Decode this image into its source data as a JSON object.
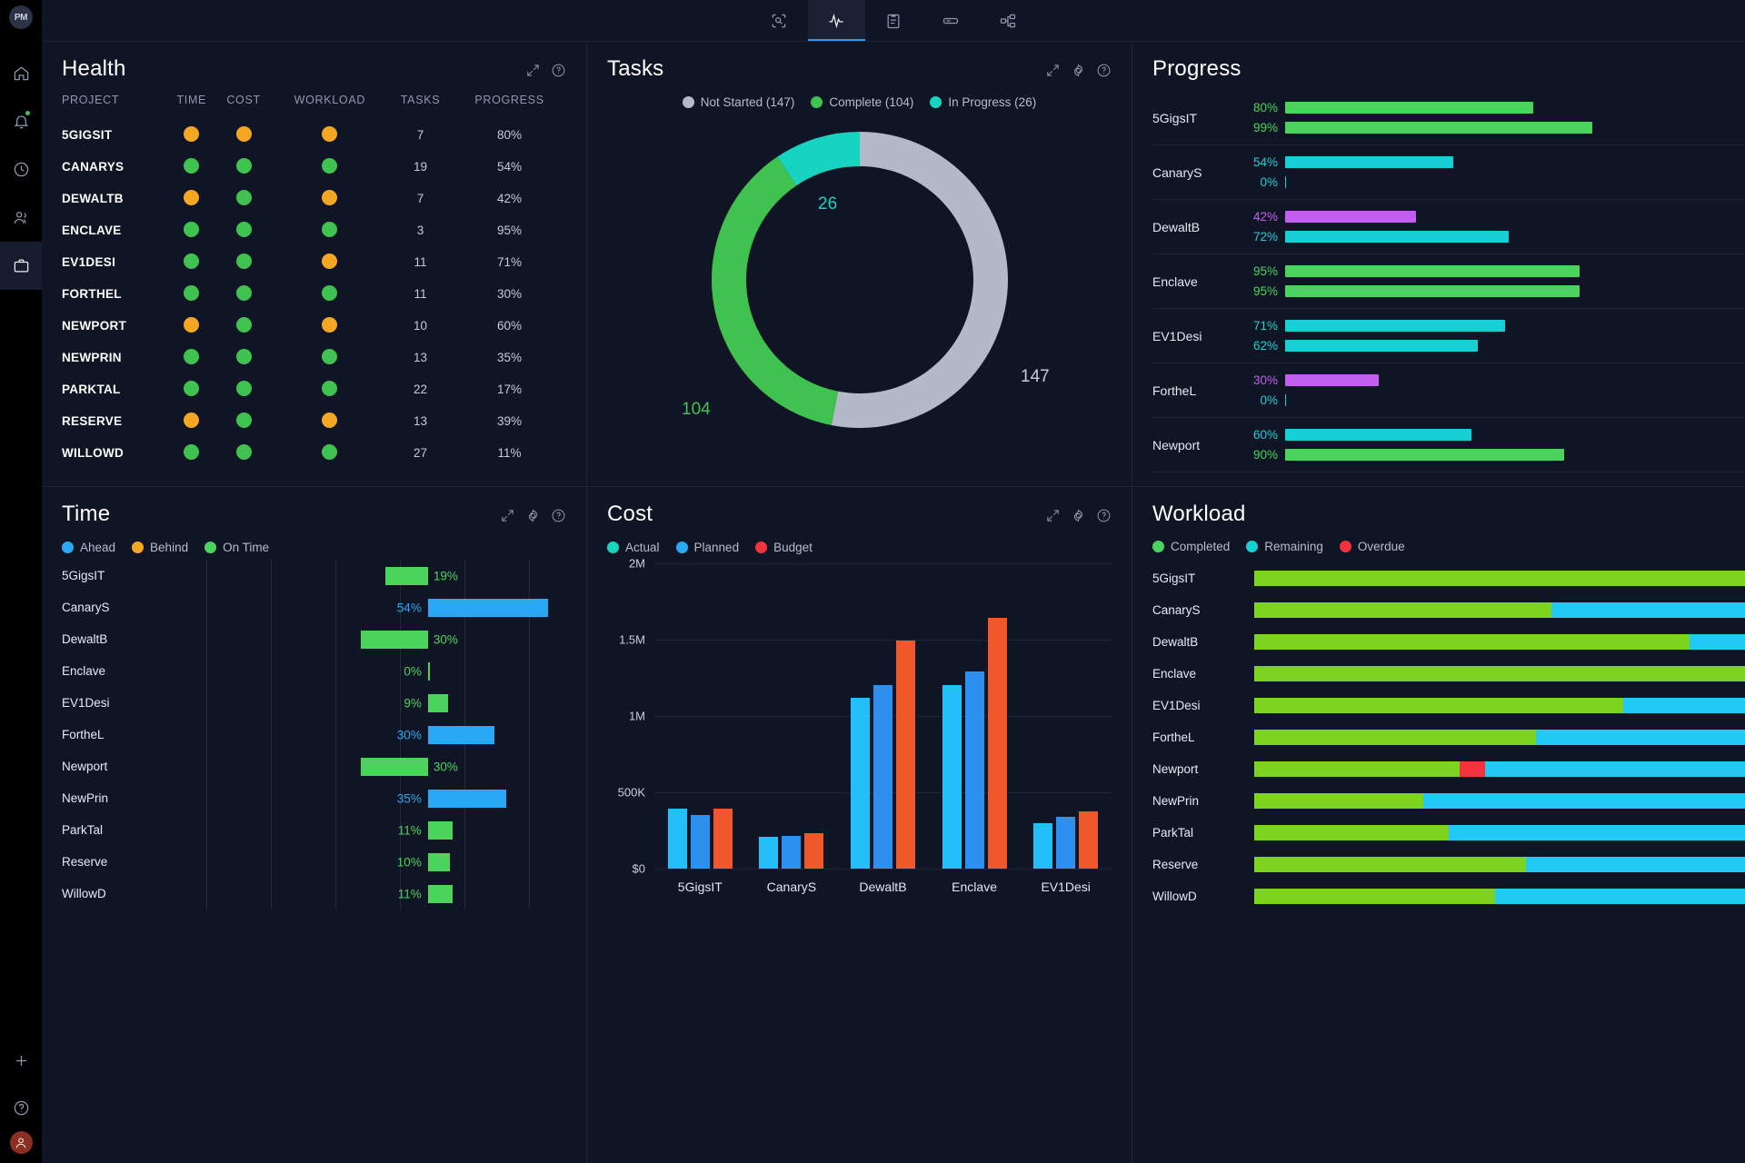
{
  "brand": {
    "logo_text": "PM"
  },
  "colors": {
    "green": "#3fc24f",
    "orange": "#f5a623",
    "blue": "#29a9f5",
    "cyan": "#17d4c0",
    "red": "#f5333f",
    "orange_bar": "#f0572a",
    "purple": "#c45ef0",
    "grey": "#b3bac7",
    "teal": "#19cfd6",
    "lightgreen": "#7ed321",
    "panel_bg": "#0f1524",
    "accent": "#2f9bf0"
  },
  "rail": {
    "items": [
      {
        "name": "home-icon",
        "label": "Home"
      },
      {
        "name": "notifications-icon",
        "label": "Notifications"
      },
      {
        "name": "timesheets-icon",
        "label": "Timesheets"
      },
      {
        "name": "people-icon",
        "label": "People"
      },
      {
        "name": "projects-icon",
        "label": "Projects"
      }
    ],
    "bottom": [
      {
        "name": "add-icon",
        "label": "Add"
      },
      {
        "name": "help-icon",
        "label": "Help"
      }
    ]
  },
  "topbar": {
    "tabs": [
      {
        "name": "tab-overview",
        "icon": "scan-icon",
        "label": "Overview",
        "active": false
      },
      {
        "name": "tab-dashboard",
        "icon": "activity-icon",
        "label": "Dashboard",
        "active": true
      },
      {
        "name": "tab-tasks",
        "icon": "clipboard-icon",
        "label": "Tasks",
        "active": false
      },
      {
        "name": "tab-board",
        "icon": "board-icon",
        "label": "Board",
        "active": false
      },
      {
        "name": "tab-workflow",
        "icon": "workflow-icon",
        "label": "Workflow",
        "active": false
      }
    ]
  },
  "health": {
    "title": "Health",
    "columns": [
      "PROJECT",
      "TIME",
      "COST",
      "WORKLOAD",
      "TASKS",
      "PROGRESS"
    ],
    "rows": [
      {
        "project": "5GIGSIT",
        "time": "orange",
        "cost": "orange",
        "workload": "orange",
        "tasks": "7",
        "progress": "80%"
      },
      {
        "project": "CANARYS",
        "time": "green",
        "cost": "green",
        "workload": "green",
        "tasks": "19",
        "progress": "54%"
      },
      {
        "project": "DEWALTB",
        "time": "orange",
        "cost": "green",
        "workload": "orange",
        "tasks": "7",
        "progress": "42%"
      },
      {
        "project": "ENCLAVE",
        "time": "green",
        "cost": "green",
        "workload": "green",
        "tasks": "3",
        "progress": "95%"
      },
      {
        "project": "EV1DESI",
        "time": "green",
        "cost": "green",
        "workload": "orange",
        "tasks": "11",
        "progress": "71%"
      },
      {
        "project": "FORTHEL",
        "time": "green",
        "cost": "green",
        "workload": "green",
        "tasks": "11",
        "progress": "30%"
      },
      {
        "project": "NEWPORT",
        "time": "orange",
        "cost": "green",
        "workload": "orange",
        "tasks": "10",
        "progress": "60%"
      },
      {
        "project": "NEWPRIN",
        "time": "green",
        "cost": "green",
        "workload": "green",
        "tasks": "13",
        "progress": "35%"
      },
      {
        "project": "PARKTAL",
        "time": "green",
        "cost": "green",
        "workload": "green",
        "tasks": "22",
        "progress": "17%"
      },
      {
        "project": "RESERVE",
        "time": "orange",
        "cost": "green",
        "workload": "orange",
        "tasks": "13",
        "progress": "39%"
      },
      {
        "project": "WILLOWD",
        "time": "green",
        "cost": "green",
        "workload": "green",
        "tasks": "27",
        "progress": "11%"
      }
    ]
  },
  "tasks": {
    "title": "Tasks",
    "chart_data": {
      "type": "pie",
      "title": "Tasks",
      "categories": [
        "Not Started",
        "Complete",
        "In Progress"
      ],
      "values": [
        147,
        104,
        26
      ],
      "colors": [
        "#b3bac7",
        "#3fc24f",
        "#17d4c0"
      ],
      "legend_position": "top",
      "labels": [
        "147",
        "104",
        "26"
      ],
      "total": 277
    },
    "legend": [
      {
        "label": "Not Started (147)",
        "color": "#b3bac7"
      },
      {
        "label": "Complete (104)",
        "color": "#3fc24f"
      },
      {
        "label": "In Progress (26)",
        "color": "#17d4c0"
      }
    ],
    "label_not_started": "147",
    "label_complete": "104",
    "label_in_progress": "26"
  },
  "progress": {
    "title": "Progress",
    "chart_data": {
      "type": "bar",
      "title": "Progress",
      "orientation": "horizontal",
      "categories": [
        "5GigsIT",
        "CanaryS",
        "DewaltB",
        "Enclave",
        "EV1Desi",
        "FortheL",
        "Newport"
      ],
      "series": [
        {
          "name": "Top",
          "values": [
            80,
            54,
            42,
            95,
            71,
            30,
            60
          ]
        },
        {
          "name": "Bottom",
          "values": [
            99,
            0,
            72,
            95,
            62,
            0,
            90
          ]
        }
      ],
      "xlim": [
        0,
        100
      ]
    },
    "rows": [
      {
        "name": "5GigsIT",
        "top_pct": "80%",
        "top_val": 80,
        "top_color": "#4ad45e",
        "bot_pct": "99%",
        "bot_val": 99,
        "bot_color": "#4ad45e"
      },
      {
        "name": "CanaryS",
        "top_pct": "54%",
        "top_val": 54,
        "top_color": "#19cfd6",
        "bot_pct": "0%",
        "bot_val": 0,
        "bot_color": "#19cfd6"
      },
      {
        "name": "DewaltB",
        "top_pct": "42%",
        "top_val": 42,
        "top_color": "#c45ef0",
        "bot_pct": "72%",
        "bot_val": 72,
        "bot_color": "#19cfd6"
      },
      {
        "name": "Enclave",
        "top_pct": "95%",
        "top_val": 95,
        "top_color": "#4ad45e",
        "bot_pct": "95%",
        "bot_val": 95,
        "bot_color": "#4ad45e"
      },
      {
        "name": "EV1Desi",
        "top_pct": "71%",
        "top_val": 71,
        "top_color": "#19cfd6",
        "bot_pct": "62%",
        "bot_val": 62,
        "bot_color": "#19cfd6"
      },
      {
        "name": "FortheL",
        "top_pct": "30%",
        "top_val": 30,
        "top_color": "#c45ef0",
        "bot_pct": "0%",
        "bot_val": 0,
        "bot_color": "#19cfd6"
      },
      {
        "name": "Newport",
        "top_pct": "60%",
        "top_val": 60,
        "top_color": "#19cfd6",
        "bot_pct": "90%",
        "bot_val": 90,
        "bot_color": "#4ad45e"
      }
    ]
  },
  "time": {
    "title": "Time",
    "legend": [
      {
        "label": "Ahead",
        "color": "#29a9f5"
      },
      {
        "label": "Behind",
        "color": "#f5a623"
      },
      {
        "label": "On Time",
        "color": "#4ad45e"
      }
    ],
    "chart_data": {
      "type": "bar",
      "title": "Time",
      "orientation": "horizontal",
      "categories": [
        "5GigsIT",
        "CanaryS",
        "DewaltB",
        "Enclave",
        "EV1Desi",
        "FortheL",
        "Newport",
        "NewPrin",
        "ParkTal",
        "Reserve",
        "WillowD"
      ],
      "values": [
        -19,
        54,
        -30,
        0,
        9,
        30,
        -30,
        35,
        11,
        -10,
        11
      ],
      "value_labels": [
        "19%",
        "54%",
        "30%",
        "0%",
        "9%",
        "30%",
        "30%",
        "35%",
        "11%",
        "10%",
        "11%"
      ],
      "legend": [
        "Ahead",
        "Behind",
        "On Time"
      ]
    },
    "rows": [
      {
        "name": "5GigsIT",
        "pct": "19%",
        "val": 19,
        "dir": "left",
        "color": "#4ad45e"
      },
      {
        "name": "CanaryS",
        "pct": "54%",
        "val": 54,
        "dir": "right",
        "color": "#29a9f5"
      },
      {
        "name": "DewaltB",
        "pct": "30%",
        "val": 30,
        "dir": "left",
        "color": "#4ad45e"
      },
      {
        "name": "Enclave",
        "pct": "0%",
        "val": 0,
        "dir": "right",
        "color": "#4ad45e"
      },
      {
        "name": "EV1Desi",
        "pct": "9%",
        "val": 9,
        "dir": "right",
        "color": "#4ad45e"
      },
      {
        "name": "FortheL",
        "pct": "30%",
        "val": 30,
        "dir": "right",
        "color": "#29a9f5"
      },
      {
        "name": "Newport",
        "pct": "30%",
        "val": 30,
        "dir": "left",
        "color": "#4ad45e"
      },
      {
        "name": "NewPrin",
        "pct": "35%",
        "val": 35,
        "dir": "right",
        "color": "#29a9f5"
      },
      {
        "name": "ParkTal",
        "pct": "11%",
        "val": 11,
        "dir": "right",
        "color": "#4ad45e"
      },
      {
        "name": "Reserve",
        "pct": "10%",
        "val": 10,
        "dir": "right",
        "color": "#4ad45e"
      },
      {
        "name": "WillowD",
        "pct": "11%",
        "val": 11,
        "dir": "right",
        "color": "#4ad45e"
      }
    ]
  },
  "cost": {
    "title": "Cost",
    "legend": [
      {
        "label": "Actual",
        "color": "#17d4c0"
      },
      {
        "label": "Planned",
        "color": "#29a9f5"
      },
      {
        "label": "Budget",
        "color": "#f5333f"
      }
    ],
    "chart_data": {
      "type": "bar",
      "title": "Cost",
      "categories": [
        "5GigsIT",
        "CanaryS",
        "DewaltB",
        "Enclave",
        "EV1Desi"
      ],
      "series": [
        {
          "name": "Actual",
          "values": [
            390000,
            210000,
            1120000,
            1200000,
            300000
          ]
        },
        {
          "name": "Planned",
          "values": [
            350000,
            215000,
            1200000,
            1290000,
            340000
          ]
        },
        {
          "name": "Budget",
          "values": [
            390000,
            235000,
            1495000,
            1640000,
            375000
          ]
        }
      ],
      "ylabel": "",
      "xlabel": "",
      "ylim": [
        0,
        2000000
      ],
      "ytick_labels": [
        "$0",
        "500K",
        "1M",
        "1.5M",
        "2M"
      ],
      "grid": true,
      "legend_position": "top"
    },
    "y_ticks": [
      {
        "label": "2M",
        "value": 2000000
      },
      {
        "label": "1.5M",
        "value": 1500000
      },
      {
        "label": "1M",
        "value": 1000000
      },
      {
        "label": "500K",
        "value": 500000
      },
      {
        "label": "$0",
        "value": 0
      }
    ],
    "groups": [
      {
        "name": "5GigsIT",
        "bars": [
          {
            "v": 390000,
            "c": "#23bffa"
          },
          {
            "v": 350000,
            "c": "#2b90f0"
          },
          {
            "v": 390000,
            "c": "#f0572a"
          }
        ]
      },
      {
        "name": "CanaryS",
        "bars": [
          {
            "v": 210000,
            "c": "#23bffa"
          },
          {
            "v": 215000,
            "c": "#2b90f0"
          },
          {
            "v": 235000,
            "c": "#f0572a"
          }
        ]
      },
      {
        "name": "DewaltB",
        "bars": [
          {
            "v": 1120000,
            "c": "#23bffa"
          },
          {
            "v": 1200000,
            "c": "#2b90f0"
          },
          {
            "v": 1495000,
            "c": "#f0572a"
          }
        ]
      },
      {
        "name": "Enclave",
        "bars": [
          {
            "v": 1200000,
            "c": "#23bffa"
          },
          {
            "v": 1290000,
            "c": "#2b90f0"
          },
          {
            "v": 1640000,
            "c": "#f0572a"
          }
        ]
      },
      {
        "name": "EV1Desi",
        "bars": [
          {
            "v": 300000,
            "c": "#23bffa"
          },
          {
            "v": 340000,
            "c": "#2b90f0"
          },
          {
            "v": 375000,
            "c": "#f0572a"
          }
        ]
      }
    ]
  },
  "workload": {
    "title": "Workload",
    "legend": [
      {
        "label": "Completed",
        "color": "#4ad45e"
      },
      {
        "label": "Remaining",
        "color": "#19cfd6"
      },
      {
        "label": "Overdue",
        "color": "#f5333f"
      }
    ],
    "chart_data": {
      "type": "bar",
      "title": "Workload",
      "orientation": "horizontal",
      "stacked": true,
      "categories": [
        "5GigsIT",
        "CanaryS",
        "DewaltB",
        "Enclave",
        "EV1Desi",
        "FortheL",
        "Newport",
        "NewPrin",
        "ParkTal",
        "Reserve",
        "WillowD"
      ],
      "series": [
        {
          "name": "Completed",
          "values": [
            100,
            58,
            85,
            100,
            72,
            55,
            40,
            33,
            38,
            53,
            47
          ]
        },
        {
          "name": "Remaining",
          "values": [
            0,
            42,
            15,
            0,
            28,
            45,
            55,
            67,
            62,
            47,
            53
          ]
        },
        {
          "name": "Overdue",
          "values": [
            0,
            0,
            0,
            0,
            0,
            0,
            5,
            0,
            0,
            0,
            0
          ]
        }
      ],
      "legend": [
        "Completed",
        "Remaining",
        "Overdue"
      ]
    },
    "rows": [
      {
        "name": "5GigsIT",
        "completed": 100,
        "remaining": 0,
        "overdue": 0
      },
      {
        "name": "CanaryS",
        "completed": 58,
        "remaining": 42,
        "overdue": 0
      },
      {
        "name": "DewaltB",
        "completed": 85,
        "remaining": 15,
        "overdue": 0
      },
      {
        "name": "Enclave",
        "completed": 100,
        "remaining": 0,
        "overdue": 0
      },
      {
        "name": "EV1Desi",
        "completed": 72,
        "remaining": 28,
        "overdue": 0
      },
      {
        "name": "FortheL",
        "completed": 55,
        "remaining": 45,
        "overdue": 0
      },
      {
        "name": "Newport",
        "completed": 40,
        "remaining": 55,
        "overdue": 5
      },
      {
        "name": "NewPrin",
        "completed": 33,
        "remaining": 67,
        "overdue": 0
      },
      {
        "name": "ParkTal",
        "completed": 38,
        "remaining": 62,
        "overdue": 0
      },
      {
        "name": "Reserve",
        "completed": 53,
        "remaining": 47,
        "overdue": 0
      },
      {
        "name": "WillowD",
        "completed": 47,
        "remaining": 53,
        "overdue": 0
      }
    ]
  }
}
